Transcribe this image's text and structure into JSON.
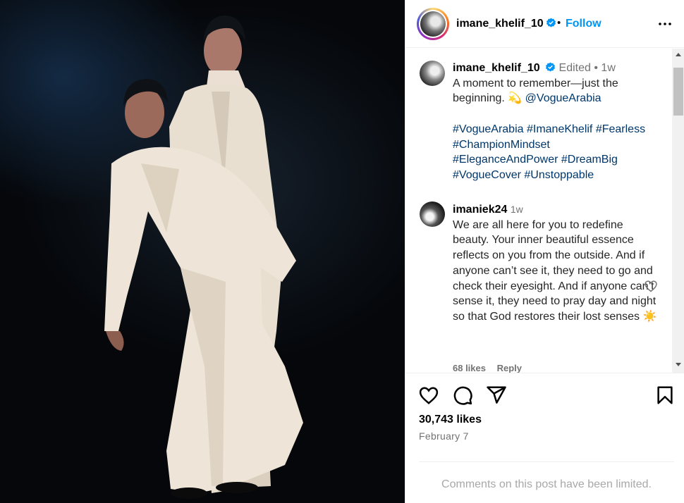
{
  "post": {
    "author": "imane_khelif_10",
    "follow_label": "Follow",
    "separator": "•",
    "caption": {
      "username": "imane_khelif_10",
      "edited_label": "Edited",
      "separator": "•",
      "time": "1w",
      "text": "A moment to remember—just the beginning. ",
      "emoji": "💫",
      "mention": "@VogueArabia",
      "hashtags": "#VogueArabia #ImaneKhelif #Fearless #ChampionMindset #EleganceAndPower #DreamBig #VogueCover #Unstoppable"
    },
    "comment": {
      "username": "imaniek24",
      "time": "1w",
      "text": "We are all here for you to redefine beauty. Your inner beautiful essence reflects on you from the outside. And if anyone can’t see it, they need to go and check their eyesight. And if anyone can’t sense it, they need to pray day and night so that God restores their lost senses ",
      "emoji": "☀️",
      "likes": "68 likes",
      "reply_label": "Reply"
    },
    "likes": "30,743 likes",
    "date": "February 7",
    "comments_limited": "Comments on this post have been limited."
  },
  "icons": {
    "verified": "verified-badge-icon",
    "more": "more-options-icon",
    "like": "heart-icon",
    "comment": "comment-icon",
    "share": "share-icon",
    "save": "bookmark-icon"
  },
  "colors": {
    "accent": "#0095f6",
    "link": "#00376b",
    "muted": "#737373",
    "limited": "#a8a8a8"
  }
}
